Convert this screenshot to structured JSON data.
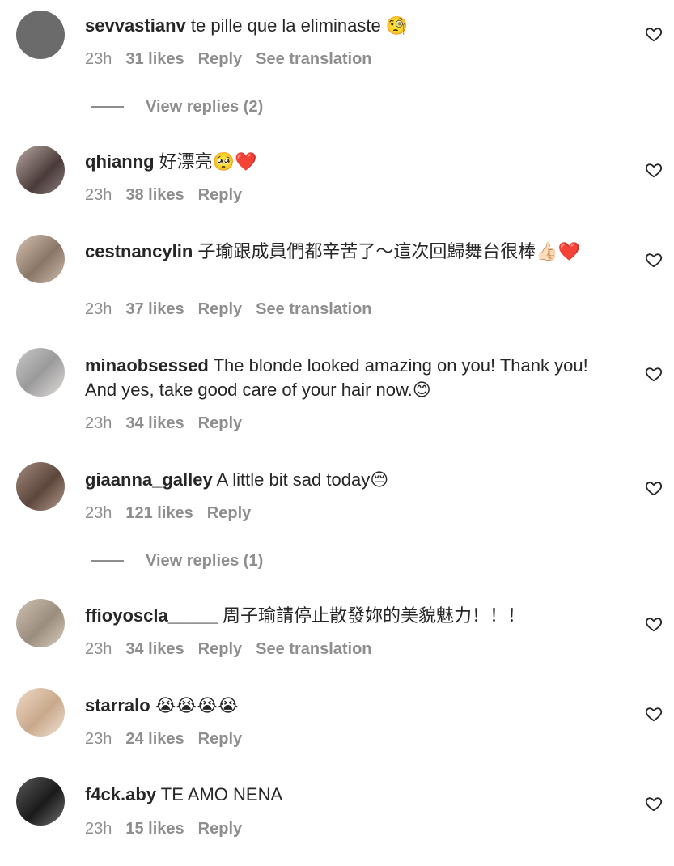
{
  "comments": [
    {
      "username": "sevvastianv",
      "text": "te pille que la eliminaste 🧐",
      "time": "23h",
      "likes": "31 likes",
      "reply": "Reply",
      "translation": "See translation"
    },
    {
      "username": "qhianng",
      "text": "好漂亮🥺❤️",
      "time": "23h",
      "likes": "38 likes",
      "reply": "Reply",
      "translation": ""
    },
    {
      "username": "cestnancylin",
      "text": "子瑜跟成員們都辛苦了～這次回歸舞台很棒👍🏻❤️",
      "time": "23h",
      "likes": "37 likes",
      "reply": "Reply",
      "translation": "See translation"
    },
    {
      "username": "minaobsessed",
      "text": "The blonde looked amazing on you! Thank you! And yes, take good care of your hair now.😊",
      "time": "23h",
      "likes": "34 likes",
      "reply": "Reply",
      "translation": ""
    },
    {
      "username": "giaanna_galley",
      "text": "A little bit sad today😔",
      "time": "23h",
      "likes": "121 likes",
      "reply": "Reply",
      "translation": ""
    },
    {
      "username": "ffioyoscla_____",
      "text": "周子瑜請停止散發妳的美貌魅力！！！",
      "time": "23h",
      "likes": "34 likes",
      "reply": "Reply",
      "translation": "See translation"
    },
    {
      "username": "starralo",
      "text": "😭😭😭😭",
      "time": "23h",
      "likes": "24 likes",
      "reply": "Reply",
      "translation": ""
    },
    {
      "username": "f4ck.aby",
      "text": "TE AMO NENA",
      "time": "23h",
      "likes": "15 likes",
      "reply": "Reply",
      "translation": ""
    }
  ],
  "view_replies": [
    "View replies (2)",
    "View replies (1)"
  ],
  "icons": {
    "heart": "heart-outline-icon"
  },
  "colors": {
    "text": "#262626",
    "secondary": "#8e8e8e",
    "background": "#ffffff"
  }
}
